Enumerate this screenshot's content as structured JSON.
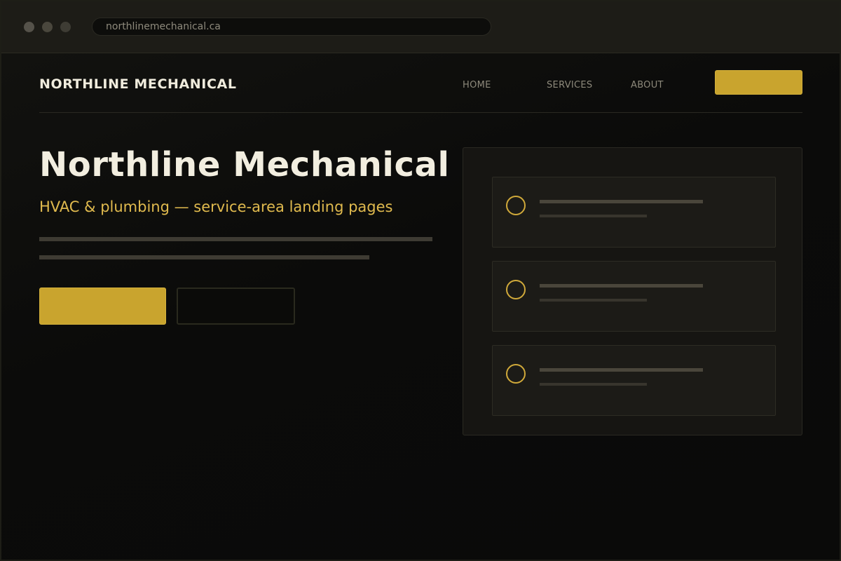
{
  "browser": {
    "url": "northlinemechanical.ca"
  },
  "nav": {
    "brand": "NORTHLINE MECHANICAL",
    "links": [
      "HOME",
      "SERVICES",
      "ABOUT"
    ],
    "cta_label": ""
  },
  "hero": {
    "title": "Northline Mechanical",
    "subtitle": "HVAC & plumbing — service-area landing pages",
    "primary_button_label": "",
    "secondary_button_label": ""
  },
  "panel": {
    "cards": [
      {
        "icon": "circle-icon"
      },
      {
        "icon": "circle-icon"
      },
      {
        "icon": "circle-icon"
      }
    ]
  },
  "colors": {
    "accent": "#c9a42e",
    "subtitle": "#e0ba4e",
    "background": "#0a0a09",
    "text": "#f2eee0"
  }
}
